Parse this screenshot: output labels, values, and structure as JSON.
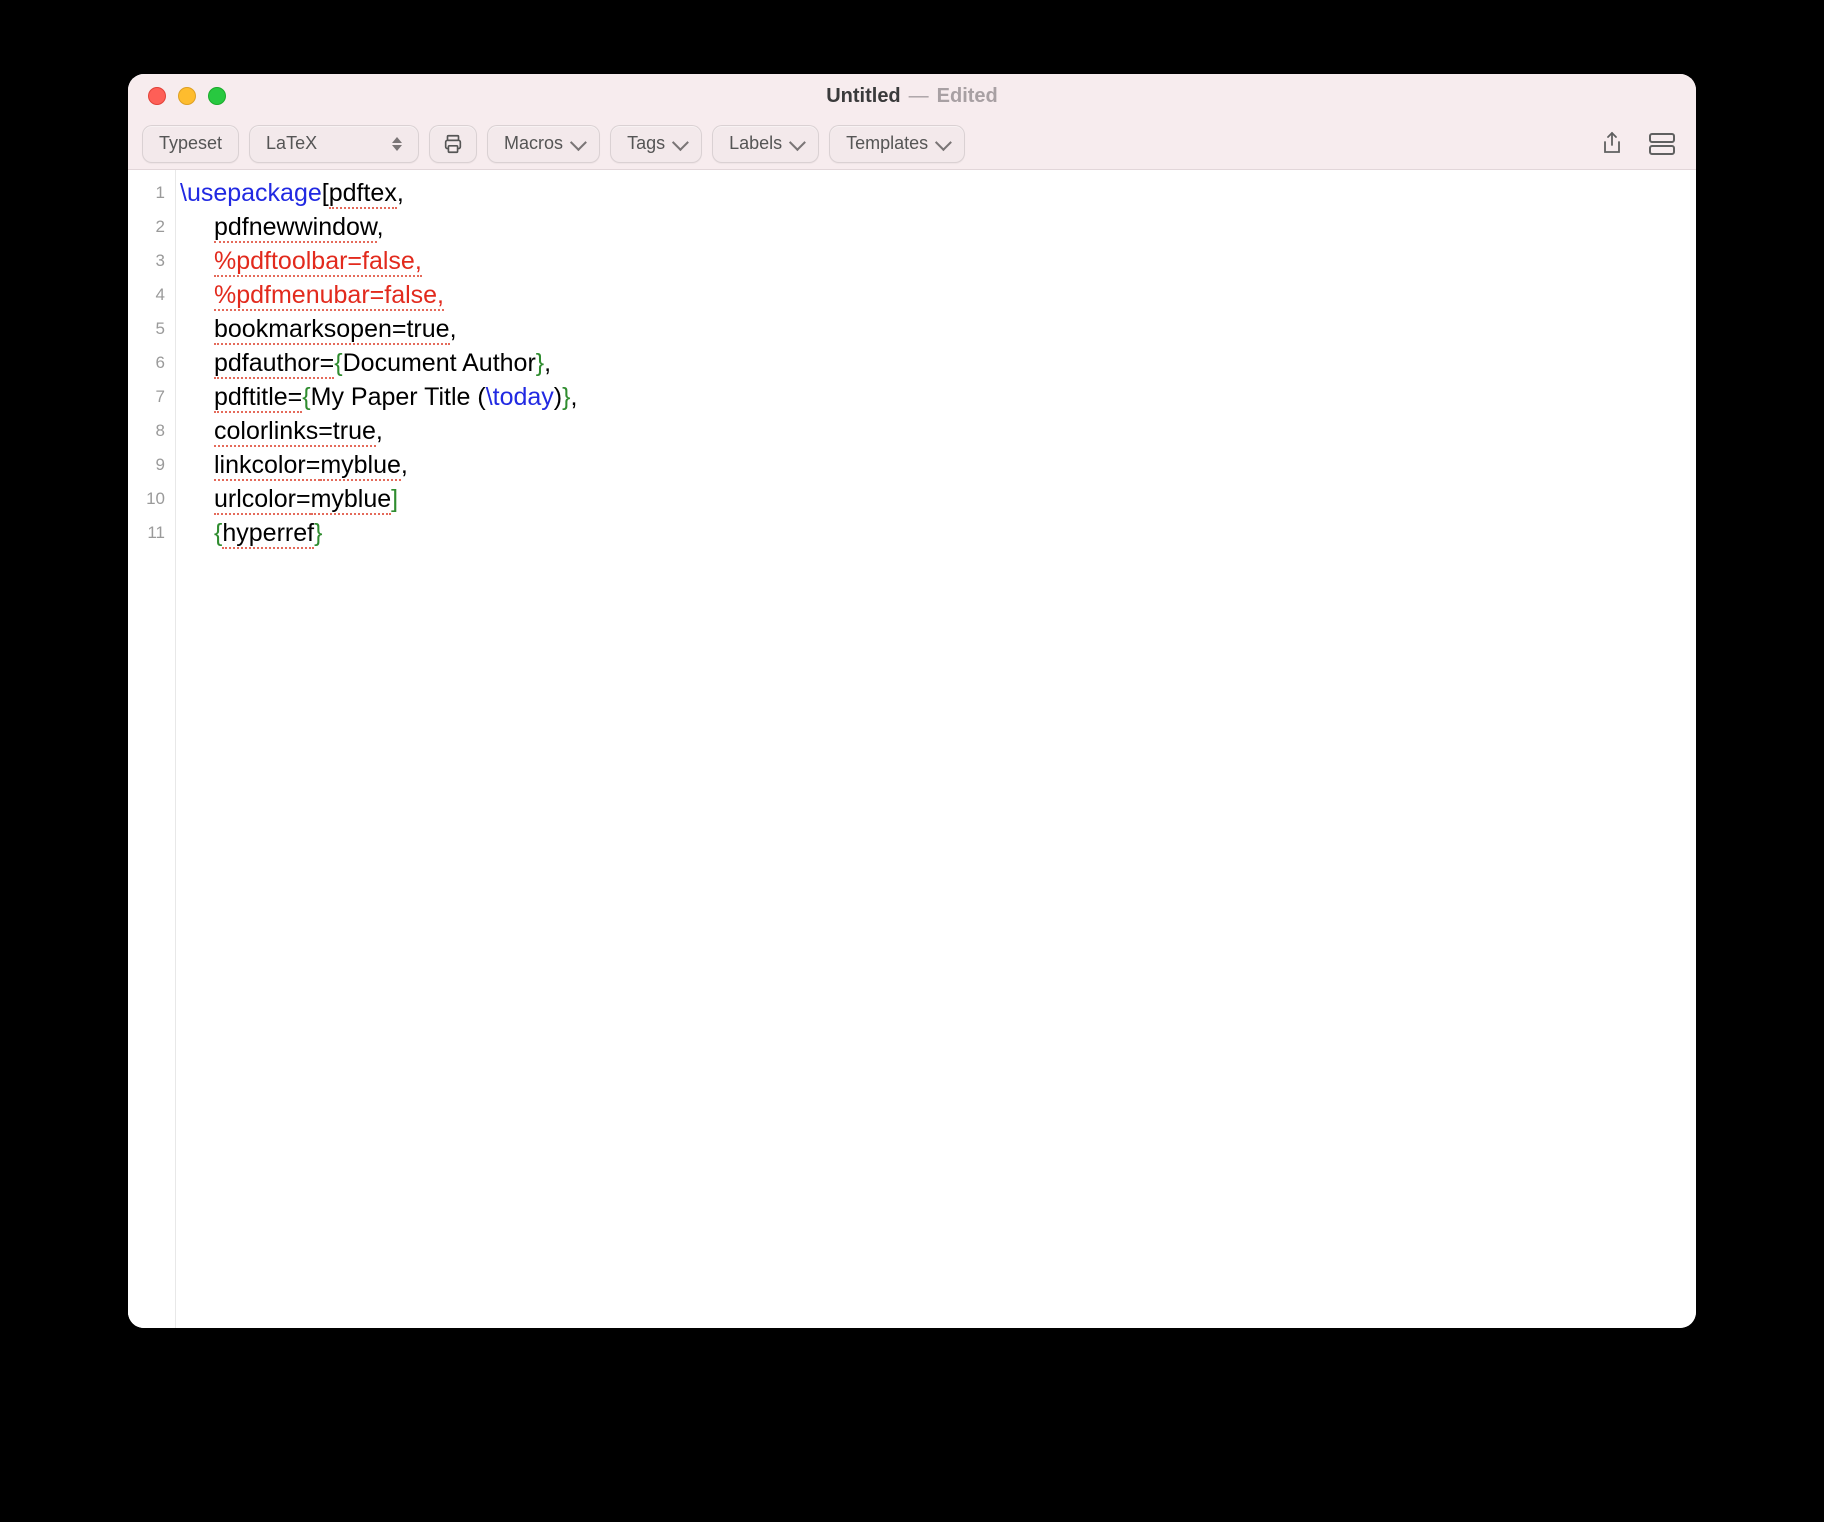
{
  "window": {
    "title": "Untitled",
    "separator": "—",
    "status": "Edited"
  },
  "toolbar": {
    "typeset": "Typeset",
    "engine": "LaTeX",
    "macros": "Macros",
    "tags": "Tags",
    "labels": "Labels",
    "templates": "Templates"
  },
  "gutter": {
    "l1": "1",
    "l2": "2",
    "l3": "3",
    "l4": "4",
    "l5": "5",
    "l6": "6",
    "l7": "7",
    "l8": "8",
    "l9": "9",
    "l10": "10",
    "l11": "11"
  },
  "code": {
    "line1_cmd": "\\usepackage",
    "line1_rest_a": "[",
    "line1_rest_b": "pdftex",
    "line1_rest_c": ",",
    "line2": "pdfnewwindow",
    "line2_tail": ",",
    "line3": "%pdftoolbar=false,",
    "line4": "%pdfmenubar=false,",
    "line5": "bookmarksopen=true",
    "line5_tail": ",",
    "line6_a": "pdfauthor=",
    "line6_b": "{",
    "line6_c": "Document Author",
    "line6_d": "}",
    "line6_e": ",",
    "line7_a": "pdftitle=",
    "line7_b": "{",
    "line7_c": "My Paper Title (",
    "line7_cmd": "\\today",
    "line7_d": ")",
    "line7_e": "}",
    "line7_f": ",",
    "line8": "colorlinks=true",
    "line8_tail": ",",
    "line9_a": "linkcolor=",
    "line9_b": "myblue",
    "line9_tail": ",",
    "line10_a": "urlcolor=",
    "line10_b": "myblue",
    "line10_c": "]",
    "line11_a": "{",
    "line11_b": "hyperref",
    "line11_c": "}"
  }
}
